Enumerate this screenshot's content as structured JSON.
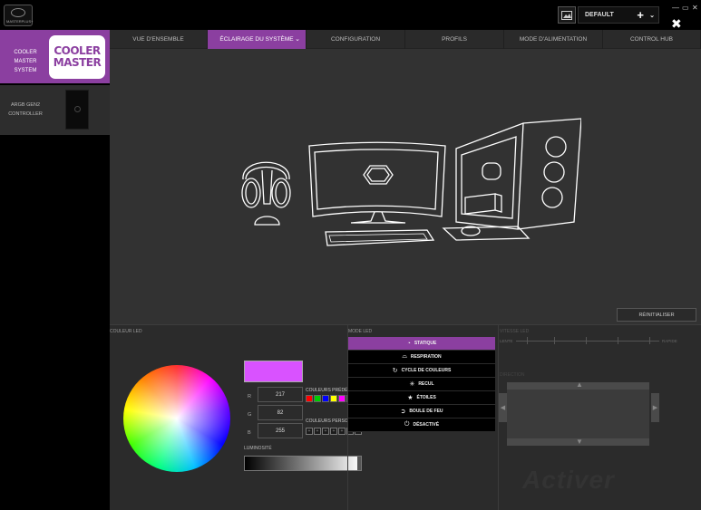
{
  "app": {
    "logo_text": "MASTERPLUS+"
  },
  "titlebar": {
    "profile": "DEFAULT",
    "plus": "+",
    "chevron": "⌄",
    "minimize": "—",
    "maximize": "▭",
    "close": "✕",
    "settings": "✖"
  },
  "sidebar": {
    "items": [
      {
        "label_line1": "COOLER MASTER",
        "label_line2": "SYSTEM",
        "logo_line1": "COOLER",
        "logo_line2": "MASTER"
      },
      {
        "label_line1": "ARGB GEN2",
        "label_line2": "CONTROLLER"
      }
    ]
  },
  "tabs": [
    {
      "label": "VUE D'ENSEMBLE",
      "active": false
    },
    {
      "label": "ÉCLAIRAGE DU SYSTÈME",
      "active": true
    },
    {
      "label": "CONFIGURATION",
      "active": false
    },
    {
      "label": "PROFILS",
      "active": false
    },
    {
      "label": "MODE D'ALIMENTATION",
      "active": false
    },
    {
      "label": "CONTROL HUB",
      "active": false
    }
  ],
  "reset_button": "RÉINITIALISER",
  "led_color": {
    "section_label": "COULEUR LED",
    "current_hex": "#d952ff",
    "r_label": "R",
    "r": "217",
    "g_label": "G",
    "g": "82",
    "b_label": "B",
    "b": "255",
    "preset_label": "COULEURS PRÉDÉFINI",
    "preset_colors": [
      "#ff0000",
      "#00cc00",
      "#0000ff",
      "#ffff00",
      "#ff00ff",
      "#00ffff"
    ],
    "custom_label": "COULEURS PERSONN",
    "custom_slots": [
      "+",
      "+",
      "+",
      "+",
      "+",
      "+",
      "+"
    ],
    "brightness_label": "LUMINOSITÉ",
    "brightness": 1.0
  },
  "led_mode": {
    "section_label": "MODE LED",
    "modes": [
      {
        "label": "STATIQUE",
        "icon": "palette-icon",
        "glyph": "◔",
        "active": true
      },
      {
        "label": "RESPIRATION",
        "icon": "breathing-icon",
        "glyph": "⌓",
        "active": false
      },
      {
        "label": "CYCLE DE COULEURS",
        "icon": "cycle-icon",
        "glyph": "↻",
        "active": false
      },
      {
        "label": "RECUL",
        "icon": "burst-icon",
        "glyph": "✳",
        "active": false
      },
      {
        "label": "ÉTOILES",
        "icon": "star-icon",
        "glyph": "★",
        "active": false
      },
      {
        "label": "BOULE DE FEU",
        "icon": "fireball-icon",
        "glyph": "➲",
        "active": false
      },
      {
        "label": "DÉSACTIVÉ",
        "icon": "power-icon",
        "glyph": "⏻",
        "active": false
      }
    ]
  },
  "led_speed": {
    "section_label": "VITESSE LED",
    "low_label": "LENTE",
    "high_label": "RAPIDE"
  },
  "direction": {
    "section_label": "DIRECTION"
  },
  "watermark": "Activer"
}
